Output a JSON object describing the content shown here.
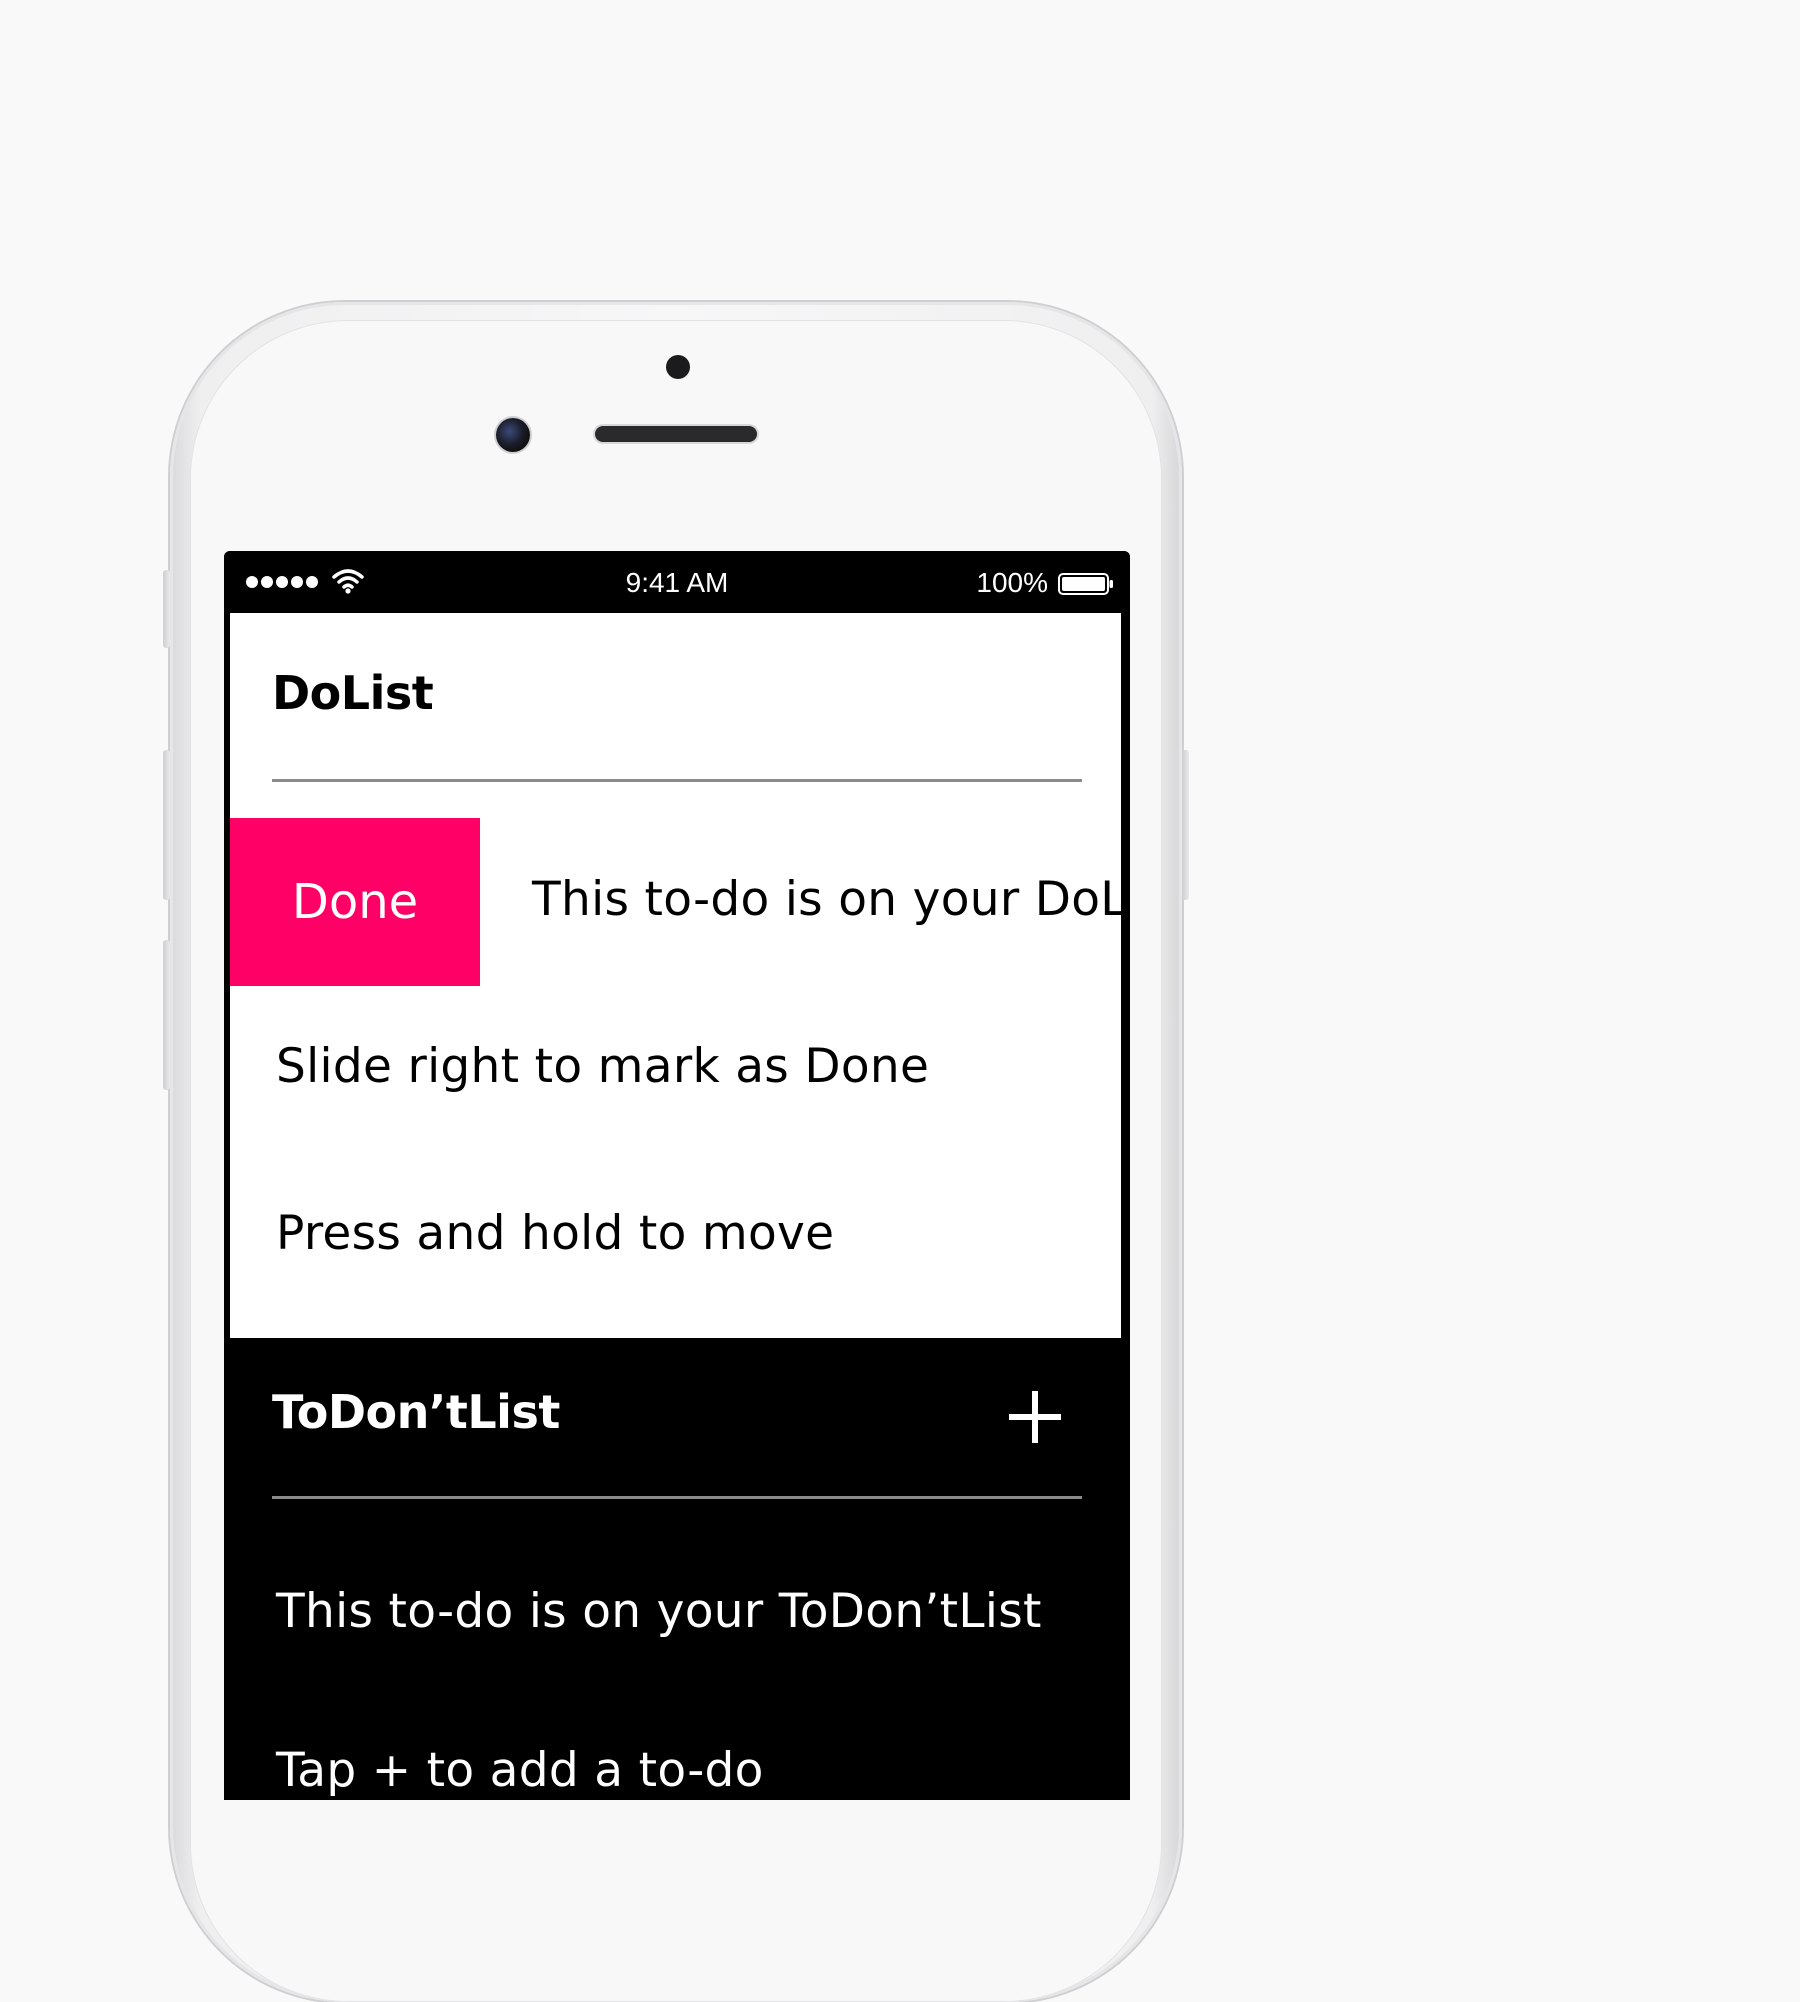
{
  "status_bar": {
    "time": "9:41 AM",
    "battery": "100%"
  },
  "dolist": {
    "title": "DoList",
    "done_action_label": "Done",
    "items": [
      {
        "text": "This to-do is on your DoList"
      },
      {
        "text": "Slide right to mark as Done"
      },
      {
        "text": "Press and hold to move"
      }
    ]
  },
  "dontlist": {
    "title": "ToDon’tList",
    "add_icon": "plus-icon",
    "items": [
      {
        "text": "This to-do is on your ToDon’tList"
      },
      {
        "text": "Tap + to add a to-do"
      }
    ]
  },
  "colors": {
    "done_accent": "#ff0066",
    "dolist_background": "#ffffff",
    "dontlist_background": "#000000"
  }
}
